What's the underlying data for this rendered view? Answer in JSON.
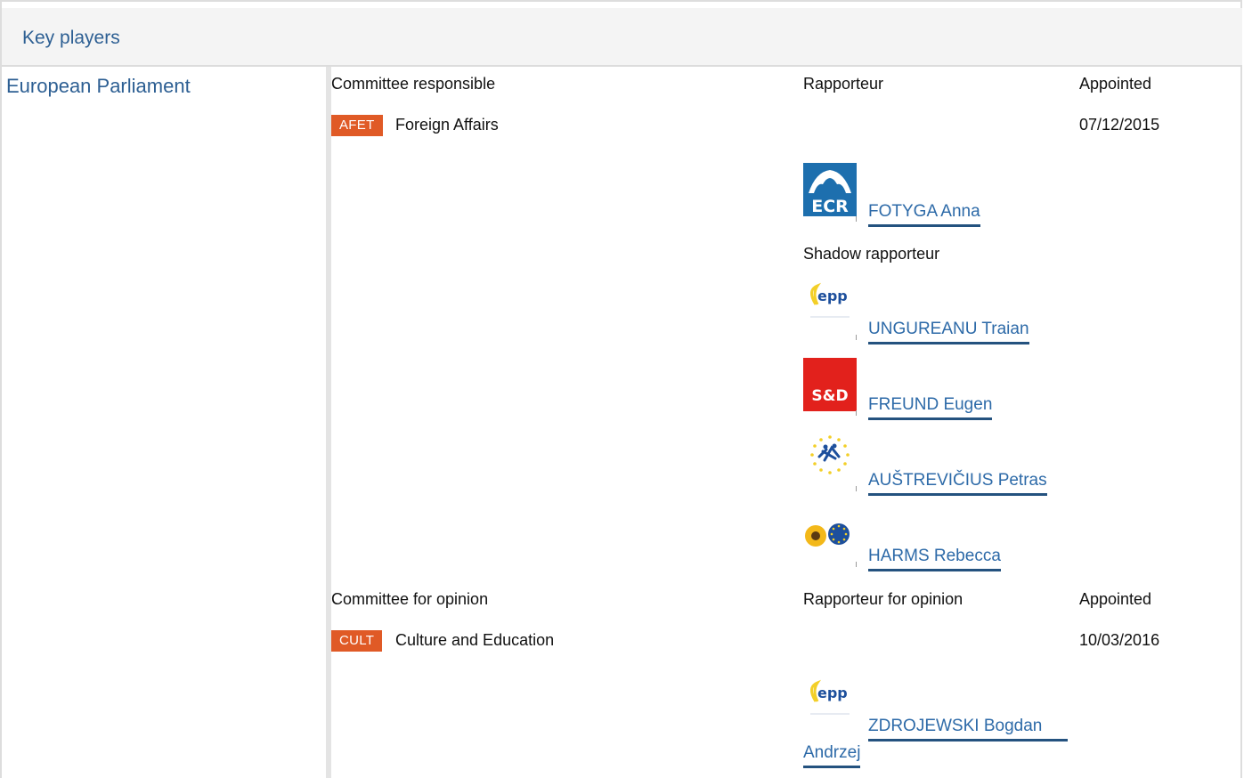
{
  "section": {
    "title": "Key players"
  },
  "institution": "European Parliament",
  "responsible": {
    "committee_header": "Committee responsible",
    "rapporteur_header": "Rapporteur",
    "appointed_header": "Appointed",
    "committee": {
      "code": "AFET",
      "name": "Foreign Affairs",
      "appointed": "07/12/2015"
    },
    "rapporteur": {
      "group_logo": "ECR",
      "name": "FOTYGA Anna"
    },
    "shadow_header": "Shadow rapporteur",
    "shadows": [
      {
        "group_logo": "epp",
        "name": "UNGUREANU Traian"
      },
      {
        "group_logo": "S&D",
        "name": "FREUND Eugen"
      },
      {
        "group_logo": "alde-icon",
        "name": "AUŠTREVIČIUS Petras"
      },
      {
        "group_logo": "greens-efa-icon",
        "name": "HARMS Rebecca"
      }
    ]
  },
  "opinion": {
    "committee_header": "Committee for opinion",
    "rapporteur_header": "Rapporteur for opinion",
    "appointed_header": "Appointed",
    "committee": {
      "code": "CULT",
      "name": "Culture and Education",
      "appointed": "10/03/2016"
    },
    "rapporteur": {
      "group_logo": "epp",
      "name_line1": "ZDROJEWSKI Bogdan",
      "name_line2": "Andrzej"
    }
  },
  "colors": {
    "accent_blue": "#2d5f93",
    "link_blue": "#2d6aa8",
    "badge_orange": "#e05a26",
    "ecr_blue": "#1d6fae",
    "sd_red": "#e2211c"
  }
}
